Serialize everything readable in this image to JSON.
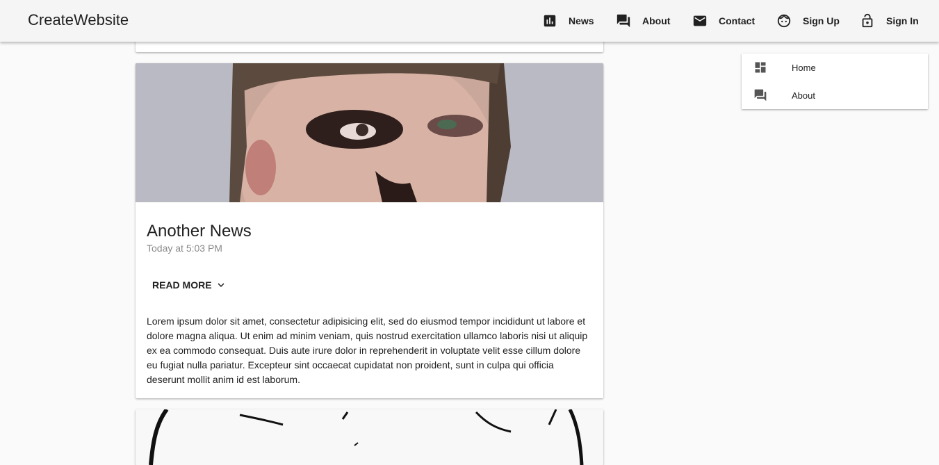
{
  "brand": "CreateWebsite",
  "nav": [
    {
      "label": "News",
      "icon": "bar-chart-icon"
    },
    {
      "label": "About",
      "icon": "forum-icon"
    },
    {
      "label": "Contact",
      "icon": "mail-icon"
    },
    {
      "label": "Sign Up",
      "icon": "face-icon"
    },
    {
      "label": "Sign In",
      "icon": "lock-open-icon"
    }
  ],
  "card": {
    "title": "Another News",
    "date": "Today at 5:03 PM",
    "read_more": "READ MORE",
    "body": "Lorem ipsum dolor sit amet, consectetur adipisicing elit, sed do eiusmod tempor incididunt ut labore et dolore magna aliqua. Ut enim ad minim veniam, quis nostrud exercitation ullamco laboris nisi ut aliquip ex ea commodo consequat. Duis aute irure dolor in reprehenderit in voluptate velit esse cillum dolore eu fugiat nulla pariatur. Excepteur sint occaecat cupidatat non proident, sunt in culpa qui officia deserunt mollit anim id est laborum."
  },
  "drawer": [
    {
      "label": "Home",
      "icon": "dashboard-icon"
    },
    {
      "label": "About",
      "icon": "forum-icon"
    }
  ]
}
